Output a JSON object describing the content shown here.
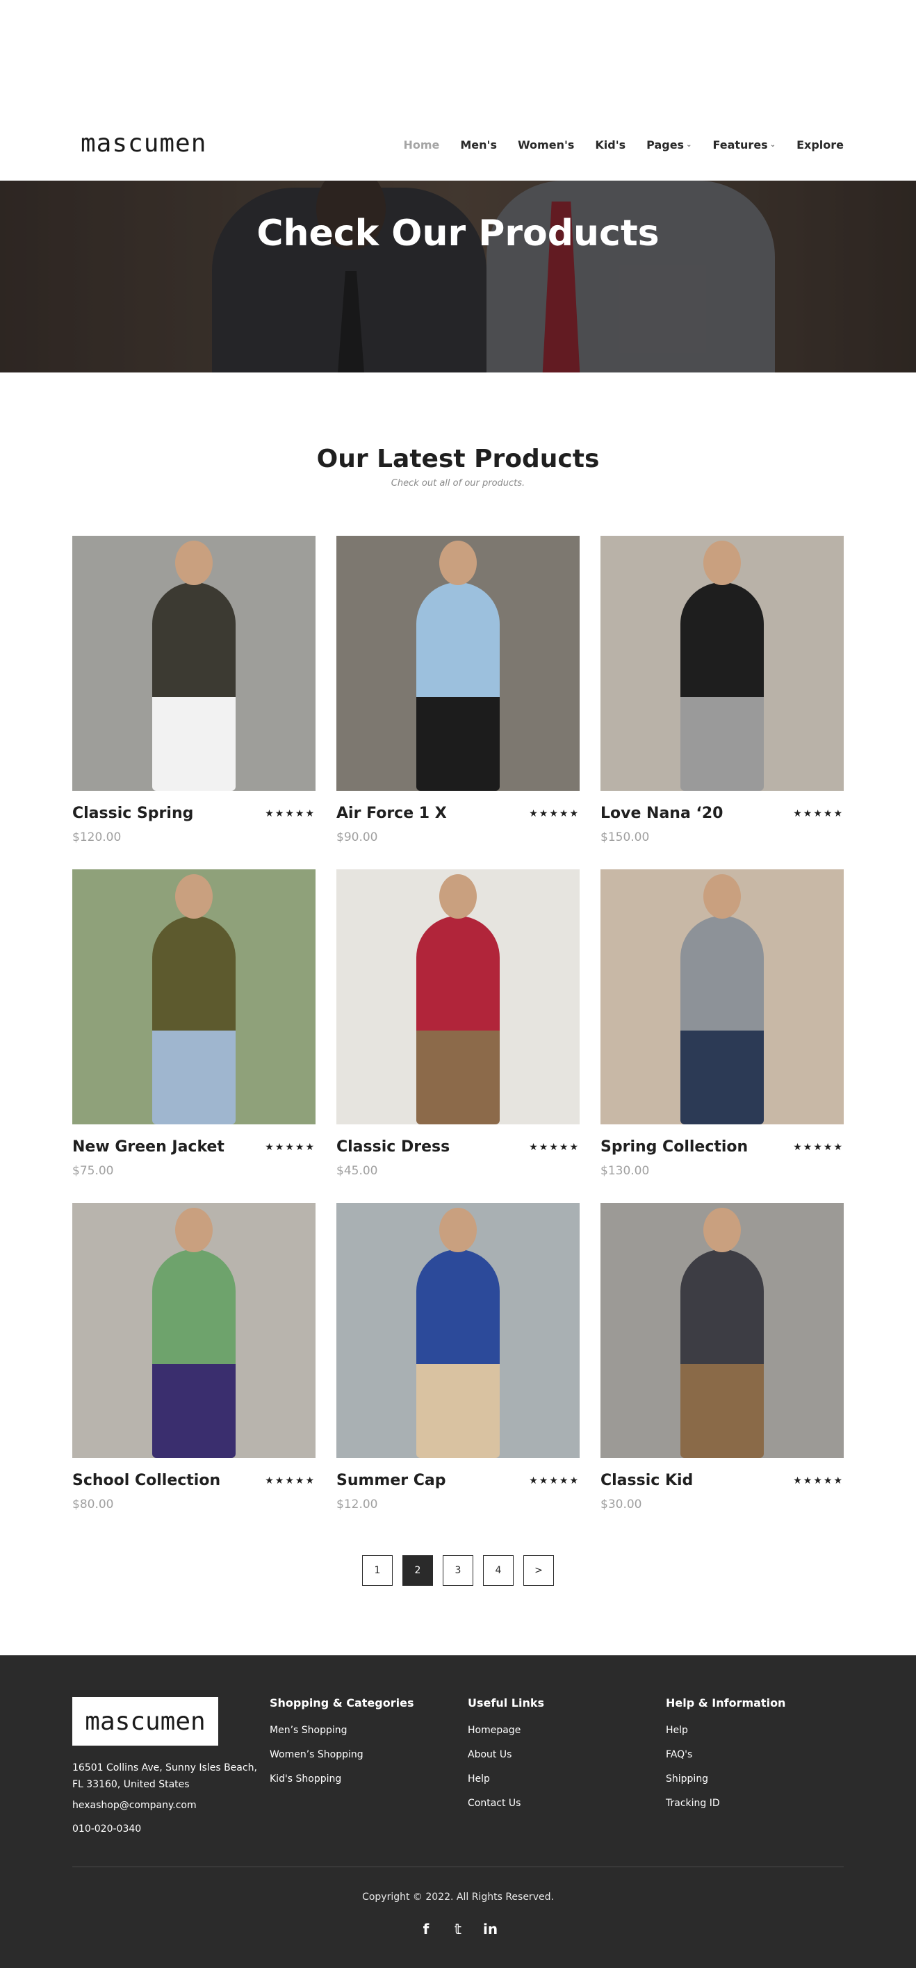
{
  "header": {
    "logo": "mascumen",
    "nav": [
      {
        "label": "Home",
        "active": true,
        "dropdown": false
      },
      {
        "label": "Men's",
        "active": false,
        "dropdown": false
      },
      {
        "label": "Women's",
        "active": false,
        "dropdown": false
      },
      {
        "label": "Kid's",
        "active": false,
        "dropdown": false
      },
      {
        "label": "Pages",
        "active": false,
        "dropdown": true
      },
      {
        "label": "Features",
        "active": false,
        "dropdown": true
      },
      {
        "label": "Explore",
        "active": false,
        "dropdown": false
      }
    ]
  },
  "hero": {
    "title": "Check Our Products"
  },
  "section": {
    "title": "Our Latest Products",
    "subtitle": "Check out all of our products."
  },
  "products": [
    {
      "name": "Classic Spring",
      "price": "$120.00",
      "rating": "★★★★★",
      "colors": {
        "bg": "#9e9e9a",
        "person": "#3c3a32",
        "accent": "#f2f2f2"
      }
    },
    {
      "name": "Air Force 1 X",
      "price": "$90.00",
      "rating": "★★★★★",
      "colors": {
        "bg": "#7d7870",
        "person": "#9cc0dd",
        "accent": "#1c1c1c"
      }
    },
    {
      "name": "Love Nana ‘20",
      "price": "$150.00",
      "rating": "★★★★★",
      "colors": {
        "bg": "#b9b2a8",
        "person": "#1e1e1e",
        "accent": "#9a9a9a"
      }
    },
    {
      "name": "New Green Jacket",
      "price": "$75.00",
      "rating": "★★★★★",
      "colors": {
        "bg": "#8fa17a",
        "person": "#5d5a2e",
        "accent": "#9fb6cf"
      }
    },
    {
      "name": "Classic Dress",
      "price": "$45.00",
      "rating": "★★★★★",
      "colors": {
        "bg": "#e6e4df",
        "person": "#b1253a",
        "accent": "#8c6a4a"
      }
    },
    {
      "name": "Spring Collection",
      "price": "$130.00",
      "rating": "★★★★★",
      "colors": {
        "bg": "#c8b8a6",
        "person": "#8d9298",
        "accent": "#2c3a55"
      }
    },
    {
      "name": "School Collection",
      "price": "$80.00",
      "rating": "★★★★★",
      "colors": {
        "bg": "#b8b4ad",
        "person": "#6ea36c",
        "accent": "#3a2e6e"
      }
    },
    {
      "name": "Summer Cap",
      "price": "$12.00",
      "rating": "★★★★★",
      "colors": {
        "bg": "#a9b0b3",
        "person": "#2c4a9a",
        "accent": "#d9c2a1"
      }
    },
    {
      "name": "Classic Kid",
      "price": "$30.00",
      "rating": "★★★★★",
      "colors": {
        "bg": "#9c9a96",
        "person": "#3d3d44",
        "accent": "#8a6a48"
      }
    }
  ],
  "pagination": {
    "pages": [
      "1",
      "2",
      "3",
      "4",
      ">"
    ],
    "active": "2"
  },
  "footer": {
    "logo": "mascumen",
    "address": "16501 Collins Ave, Sunny Isles Beach, FL 33160, United States",
    "email": "hexashop@company.com",
    "phone": "010-020-0340",
    "columns": [
      {
        "title": "Shopping & Categories",
        "links": [
          "Men’s Shopping",
          "Women’s Shopping",
          "Kid's Shopping"
        ]
      },
      {
        "title": "Useful Links",
        "links": [
          "Homepage",
          "About Us",
          "Help",
          "Contact Us"
        ]
      },
      {
        "title": "Help & Information",
        "links": [
          "Help",
          "FAQ's",
          "Shipping",
          "Tracking ID"
        ]
      }
    ],
    "copyright": "Copyright © 2022. All Rights Reserved.",
    "socials": [
      {
        "icon": "facebook-icon",
        "glyph": "f"
      },
      {
        "icon": "twitter-icon",
        "glyph": "𝕥"
      },
      {
        "icon": "linkedin-icon",
        "glyph": "in"
      }
    ]
  }
}
